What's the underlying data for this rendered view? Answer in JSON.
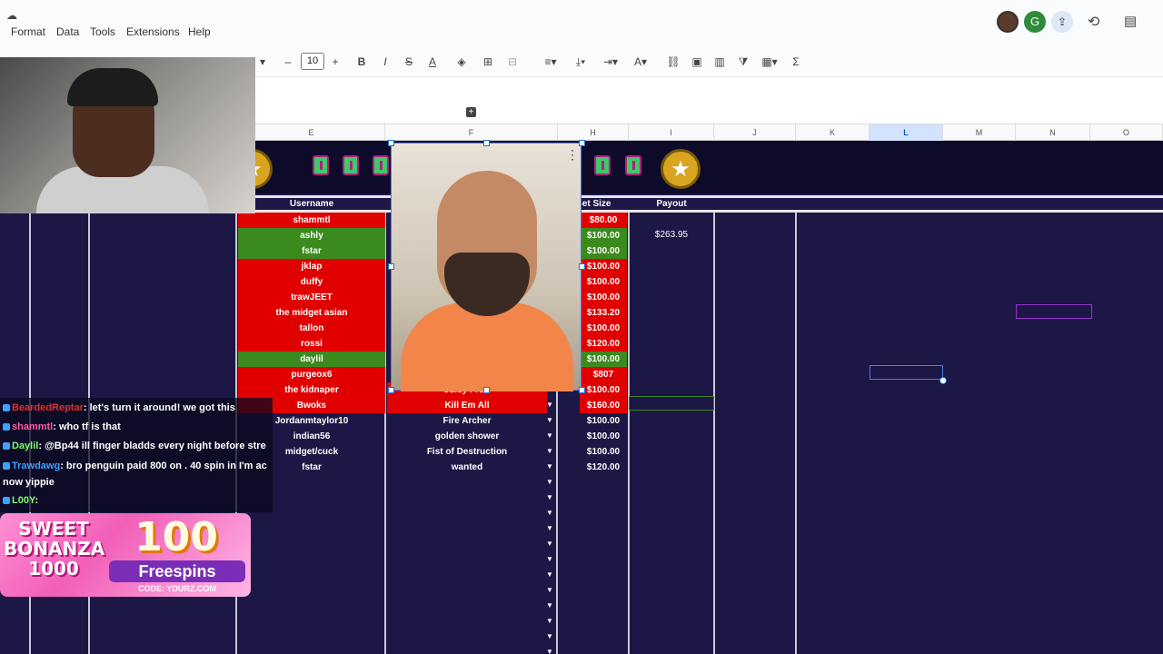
{
  "menu": {
    "items": [
      "Format",
      "Data",
      "Tools",
      "Extensions",
      "Help"
    ]
  },
  "toolbar": {
    "font_size": "10",
    "minus": "–",
    "plus": "+",
    "bold": "B",
    "italic": "I",
    "strike": "S",
    "textcolor": "A",
    "sigma": "Σ"
  },
  "header_avatars": {
    "letter": "G"
  },
  "columns": [
    "E",
    "F",
    "H",
    "I",
    "J",
    "K",
    "L",
    "M",
    "N",
    "O"
  ],
  "sheet": {
    "headers": {
      "username": "Username",
      "bet_size": "Bet Size",
      "payout": "Payout"
    },
    "payout_value": "$263.95",
    "rows": [
      {
        "user": "shammtl",
        "game": "",
        "bet": "$80.00",
        "color": "red"
      },
      {
        "user": "ashly",
        "game": "",
        "bet": "$100.00",
        "color": "green"
      },
      {
        "user": "fstar",
        "game": "",
        "bet": "$100.00",
        "color": "green"
      },
      {
        "user": "jklap",
        "game": "",
        "bet": "$100.00",
        "color": "red"
      },
      {
        "user": "duffy",
        "game": "",
        "bet": "$100.00",
        "color": "red"
      },
      {
        "user": "trawJEET",
        "game": "",
        "bet": "$100.00",
        "color": "red"
      },
      {
        "user": "the midget asian",
        "game": "",
        "bet": "$133.20",
        "color": "red"
      },
      {
        "user": "tallon",
        "game": "",
        "bet": "$100.00",
        "color": "red"
      },
      {
        "user": "rossi",
        "game": "",
        "bet": "$120.00",
        "color": "red"
      },
      {
        "user": "daylil",
        "game": "",
        "bet": "$100.00",
        "color": "green"
      },
      {
        "user": "purgeox6",
        "game": "",
        "bet": "$807",
        "color": "red"
      },
      {
        "user": "the kidnaper",
        "game": "Juicy Fruit",
        "bet": "$100.00",
        "color": "red"
      },
      {
        "user": "Bwoks",
        "game": "Kill Em All",
        "bet": "$160.00",
        "color": "red"
      },
      {
        "user": "Jordanmtaylor10",
        "game": "Fire Archer",
        "bet": "$100.00",
        "color": "none"
      },
      {
        "user": "indian56",
        "game": "golden shower",
        "bet": "$100.00",
        "color": "none"
      },
      {
        "user": "midget/cuck",
        "game": "Fist of Destruction",
        "bet": "$100.00",
        "color": "none"
      },
      {
        "user": "fstar",
        "game": "wanted",
        "bet": "$120.00",
        "color": "none"
      }
    ]
  },
  "chat": [
    {
      "user": "BeardedReptar",
      "msg": ": let's turn it around! we got this",
      "color": "#e03030"
    },
    {
      "user": "shammtl",
      "msg": ": who tf is that",
      "color": "#ff5aa0"
    },
    {
      "user": "Daylil",
      "msg": ": @Bp44 ill finger bladds every night before stre",
      "color": "#7cff6a"
    },
    {
      "user": "Trawdawg",
      "msg": ": bro penguin paid 800 on . 40 spin in I'm ac",
      "color": "#3ea0ff"
    },
    {
      "user": "",
      "msg": "now yippie",
      "color": "#ffffff"
    },
    {
      "user": "L00Y",
      "msg": ": ",
      "color": "#7cff6a"
    }
  ],
  "ad": {
    "title_line1": "SWEET",
    "title_line2": "BONANZA",
    "title_line3": "1000",
    "big": "100",
    "free": "Freespins",
    "code": "CODE: YDURZ.COM"
  }
}
